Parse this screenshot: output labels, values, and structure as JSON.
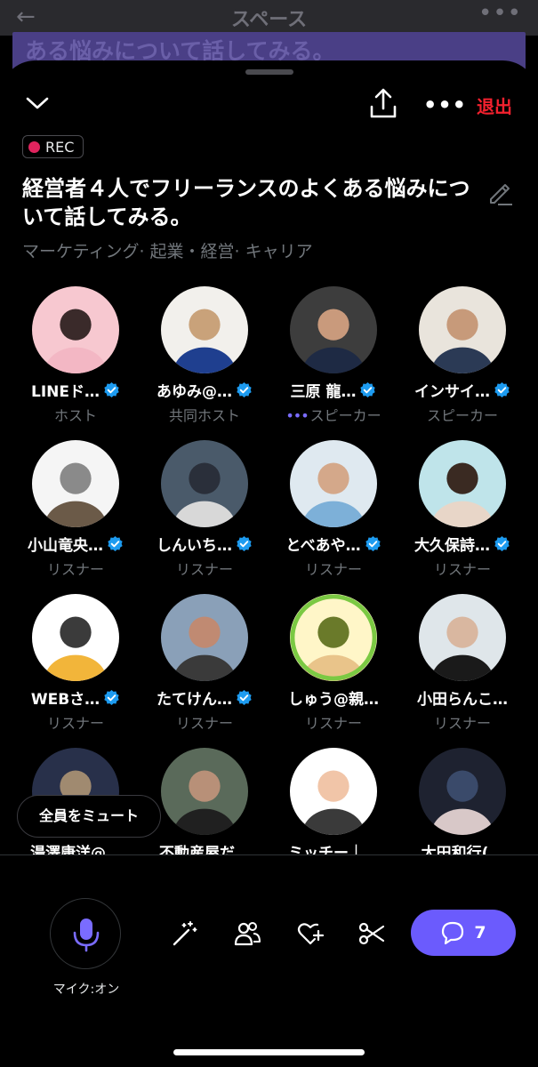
{
  "background_app": {
    "title": "スペース",
    "banner_text": "ある悩みについて話してみる。"
  },
  "topbar": {
    "collapse_icon": "chevron-down-icon",
    "share_icon": "share-icon",
    "more_icon": "more-dots-icon",
    "more_label": "•••",
    "exit_label": "退出"
  },
  "rec_badge": "REC",
  "space": {
    "title": "経営者４人でフリーランスのよくある悩みについて話してみる。",
    "topics": "マーケティング· 起業・経営· キャリア"
  },
  "participants": [
    {
      "name": "LINEド…",
      "role": "ホスト",
      "verified": true,
      "speaking": false
    },
    {
      "name": "あゆみ@…",
      "role": "共同ホスト",
      "verified": true,
      "speaking": false
    },
    {
      "name": "三原 龍…",
      "role": "スピーカー",
      "verified": true,
      "speaking": true
    },
    {
      "name": "インサイ…",
      "role": "スピーカー",
      "verified": true,
      "speaking": false
    },
    {
      "name": "小山竜央…",
      "role": "リスナー",
      "verified": true,
      "speaking": false
    },
    {
      "name": "しんいち…",
      "role": "リスナー",
      "verified": true,
      "speaking": false
    },
    {
      "name": "とべあや…",
      "role": "リスナー",
      "verified": true,
      "speaking": false
    },
    {
      "name": "大久保詩…",
      "role": "リスナー",
      "verified": true,
      "speaking": false
    },
    {
      "name": "WEBさ…",
      "role": "リスナー",
      "verified": true,
      "speaking": false
    },
    {
      "name": "たてけん…",
      "role": "リスナー",
      "verified": true,
      "speaking": false
    },
    {
      "name": "しゅう@親…",
      "role": "リスナー",
      "verified": false,
      "speaking": false
    },
    {
      "name": "小田らんこ…",
      "role": "リスナー",
      "verified": false,
      "speaking": false
    },
    {
      "name": "湯澤康洋@…",
      "role": "",
      "verified": false,
      "speaking": false
    },
    {
      "name": "不動産屋だ…",
      "role": "",
      "verified": false,
      "speaking": false
    },
    {
      "name": "ミッチー｜…",
      "role": "",
      "verified": false,
      "speaking": false
    },
    {
      "name": "太田和行(…",
      "role": "",
      "verified": false,
      "speaking": false
    }
  ],
  "mute_all_label": "全員をミュート",
  "controls": {
    "mic_label": "マイク:オン",
    "comment_count": "7",
    "icons": [
      "mic-icon",
      "magic-wand-icon",
      "people-icon",
      "heart-plus-icon",
      "scissors-icon",
      "comment-icon"
    ]
  },
  "colors": {
    "accent": "#6b5bfd",
    "exit": "#f4212e",
    "verified": "#1d9bf0",
    "rec_dot": "#e0245e",
    "muted_text": "#71767b"
  }
}
